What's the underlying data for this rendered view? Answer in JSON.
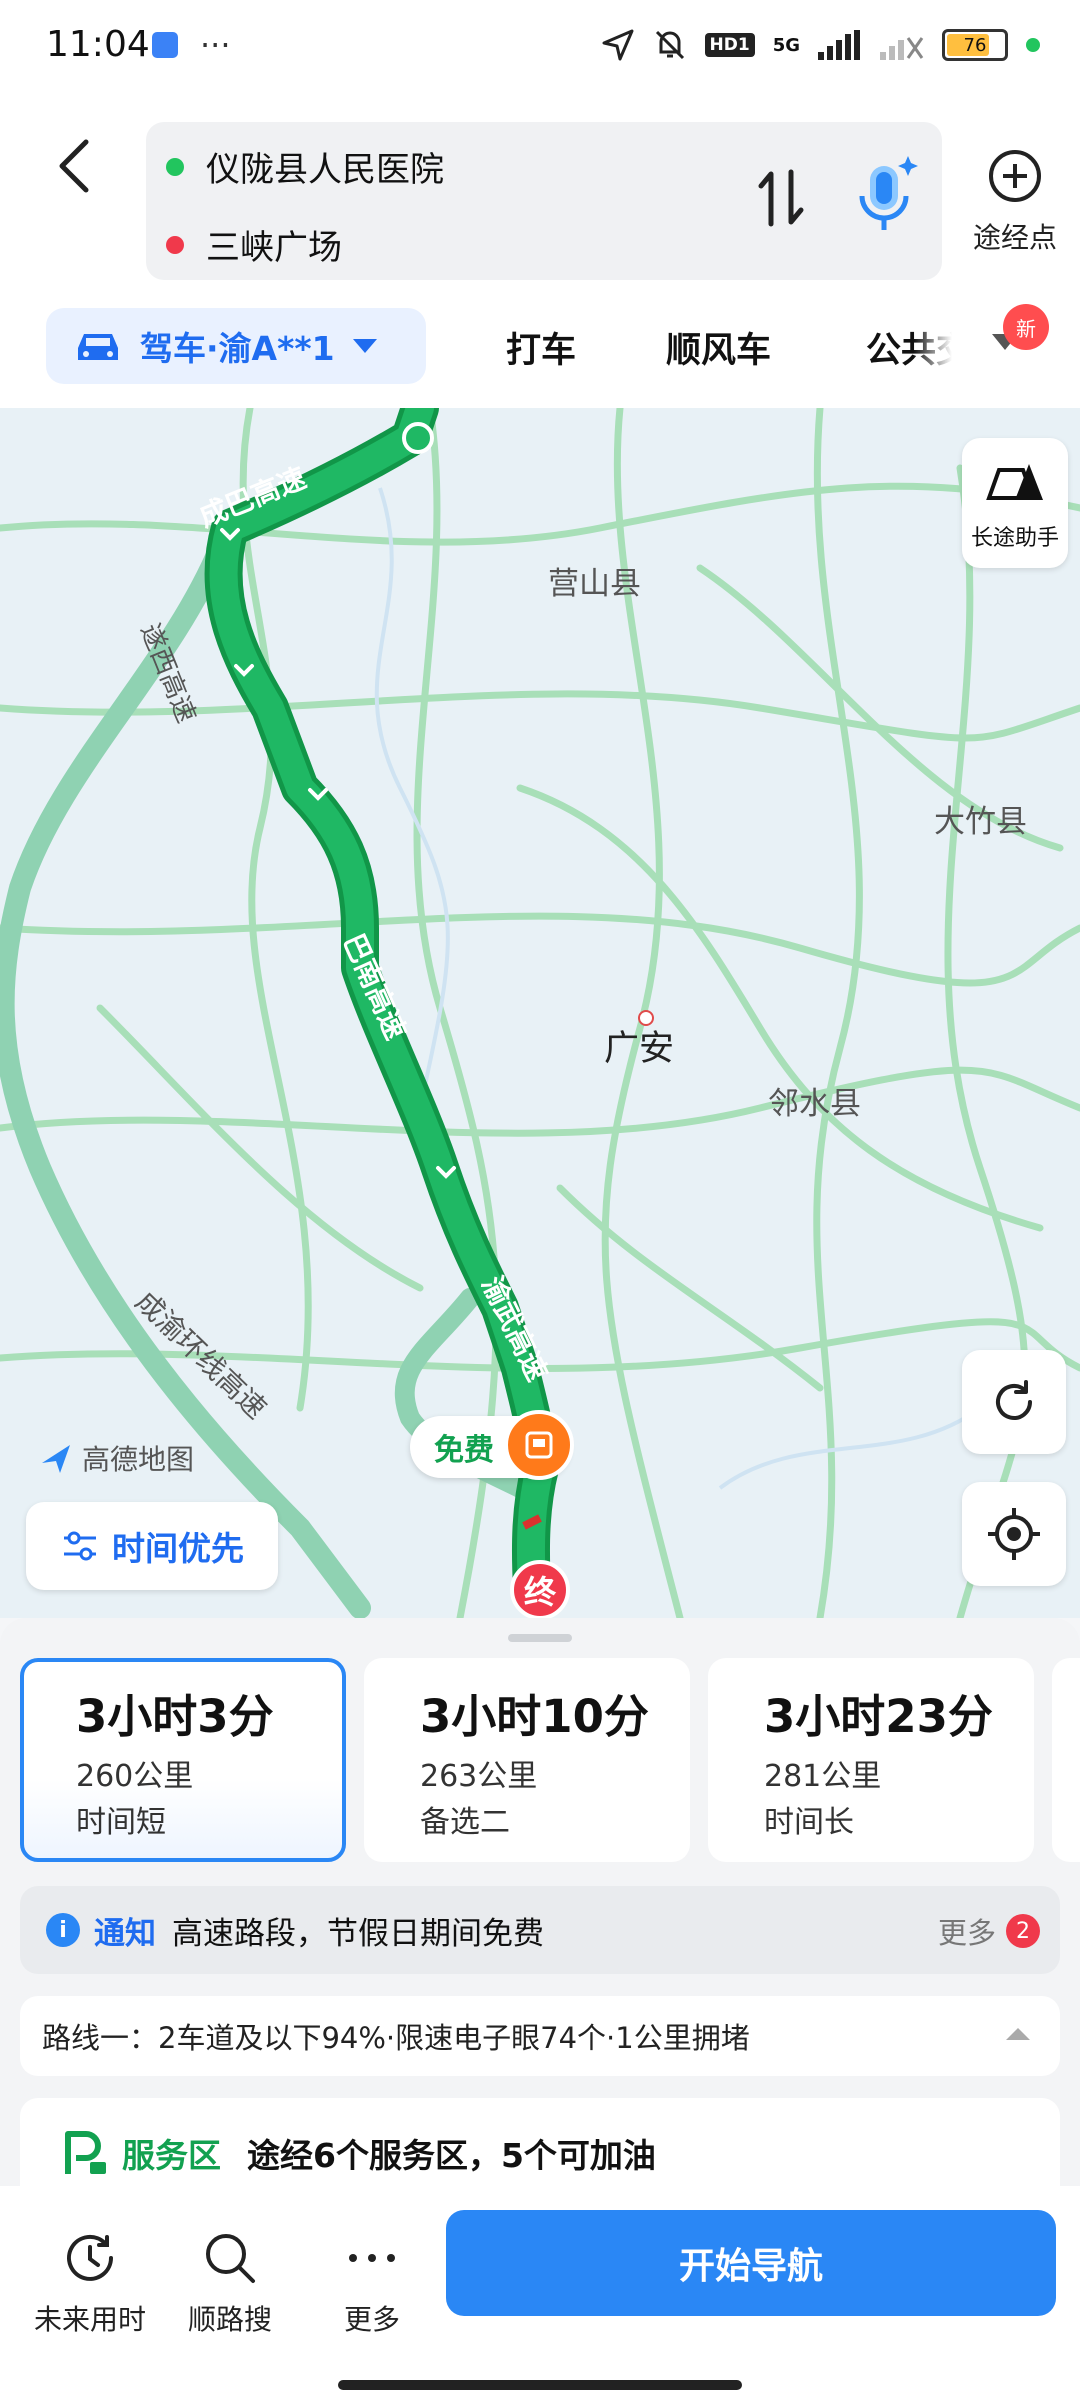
{
  "status_bar": {
    "time": "11:04",
    "battery": "76",
    "network": "5G",
    "hd": "HD1"
  },
  "header": {
    "origin": "仪陇县人民医院",
    "destination": "三峡广场",
    "waypoint_label": "途经点"
  },
  "modes": {
    "drive_label": "驾车·渝A**1",
    "tabs": [
      "打车",
      "顺风车",
      "公共交"
    ],
    "new_badge": "新"
  },
  "map": {
    "long_trip_label": "长途助手",
    "places": [
      "营山县",
      "大竹县",
      "广安",
      "邻水县"
    ],
    "roads": [
      "成巴高速",
      "遂西高速",
      "巴南高速",
      "渝武高速",
      "成渝环线高速"
    ],
    "brand": "高德地图",
    "toll_free": "免费",
    "end_marker": "终",
    "time_priority": "时间优先",
    "colors": {
      "route": "#1aab5a",
      "alt_route": "#8fd2b2",
      "roads": "#a8dfb8"
    }
  },
  "routes": [
    {
      "time": "3小时3分",
      "distance": "260公里",
      "note": "时间短",
      "selected": true
    },
    {
      "time": "3小时10分",
      "distance": "263公里",
      "note": "备选二",
      "selected": false
    },
    {
      "time": "3小时23分",
      "distance": "281公里",
      "note": "时间长",
      "selected": false
    }
  ],
  "notice": {
    "icon": "i",
    "tag": "通知",
    "text": "高速路段，节假日期间免费",
    "more": "更多",
    "count": "2"
  },
  "route_detail": "路线一：2车道及以下94%·限速电子眼74个·1公里拥堵",
  "service": {
    "tag": "服务区",
    "text": "途经6个服务区，5个可加油"
  },
  "bottom": {
    "future_time": "未来用时",
    "along_search": "顺路搜",
    "more": "更多",
    "start": "开始导航"
  }
}
